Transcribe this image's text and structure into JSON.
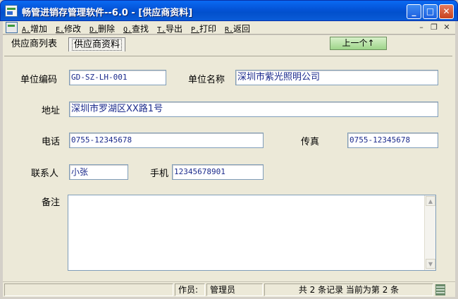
{
  "window": {
    "title": "畅管进销存管理软件--6.0 - [供应商资料]",
    "min_icon": "minimize-icon",
    "max_icon": "maximize-icon",
    "close_icon": "close-icon"
  },
  "menu": {
    "items": [
      {
        "key": "A.",
        "label": "增加"
      },
      {
        "key": "E.",
        "label": "修改"
      },
      {
        "key": "D.",
        "label": "删除"
      },
      {
        "key": "Q.",
        "label": "查找"
      },
      {
        "key": "T.",
        "label": "导出"
      },
      {
        "key": "P.",
        "label": "打印"
      },
      {
        "key": "R.",
        "label": "返回"
      }
    ],
    "mdi_min": "–",
    "mdi_restore": "❐",
    "mdi_close": "✕"
  },
  "tabs": {
    "list": "供应商列表",
    "detail": "供应商资料"
  },
  "prev_button": "上一个↑",
  "form": {
    "code_label": "单位编码",
    "code_value": "GD-SZ-LH-001",
    "name_label": "单位名称",
    "name_value": "深圳市紫光照明公司",
    "address_label": "地址",
    "address_value": "深圳市罗湖区XX路1号",
    "phone_label": "电话",
    "phone_value": "0755-12345678",
    "fax_label": "传真",
    "fax_value": "0755-12345678",
    "contact_label": "联系人",
    "contact_value": "小张",
    "mobile_label": "手机",
    "mobile_value": "12345678901",
    "memo_label": "备注",
    "memo_value": ""
  },
  "status": {
    "operator_label": "作员:",
    "operator_value": "管理员",
    "record_info": "共 2 条记录 当前为第 2 条"
  }
}
